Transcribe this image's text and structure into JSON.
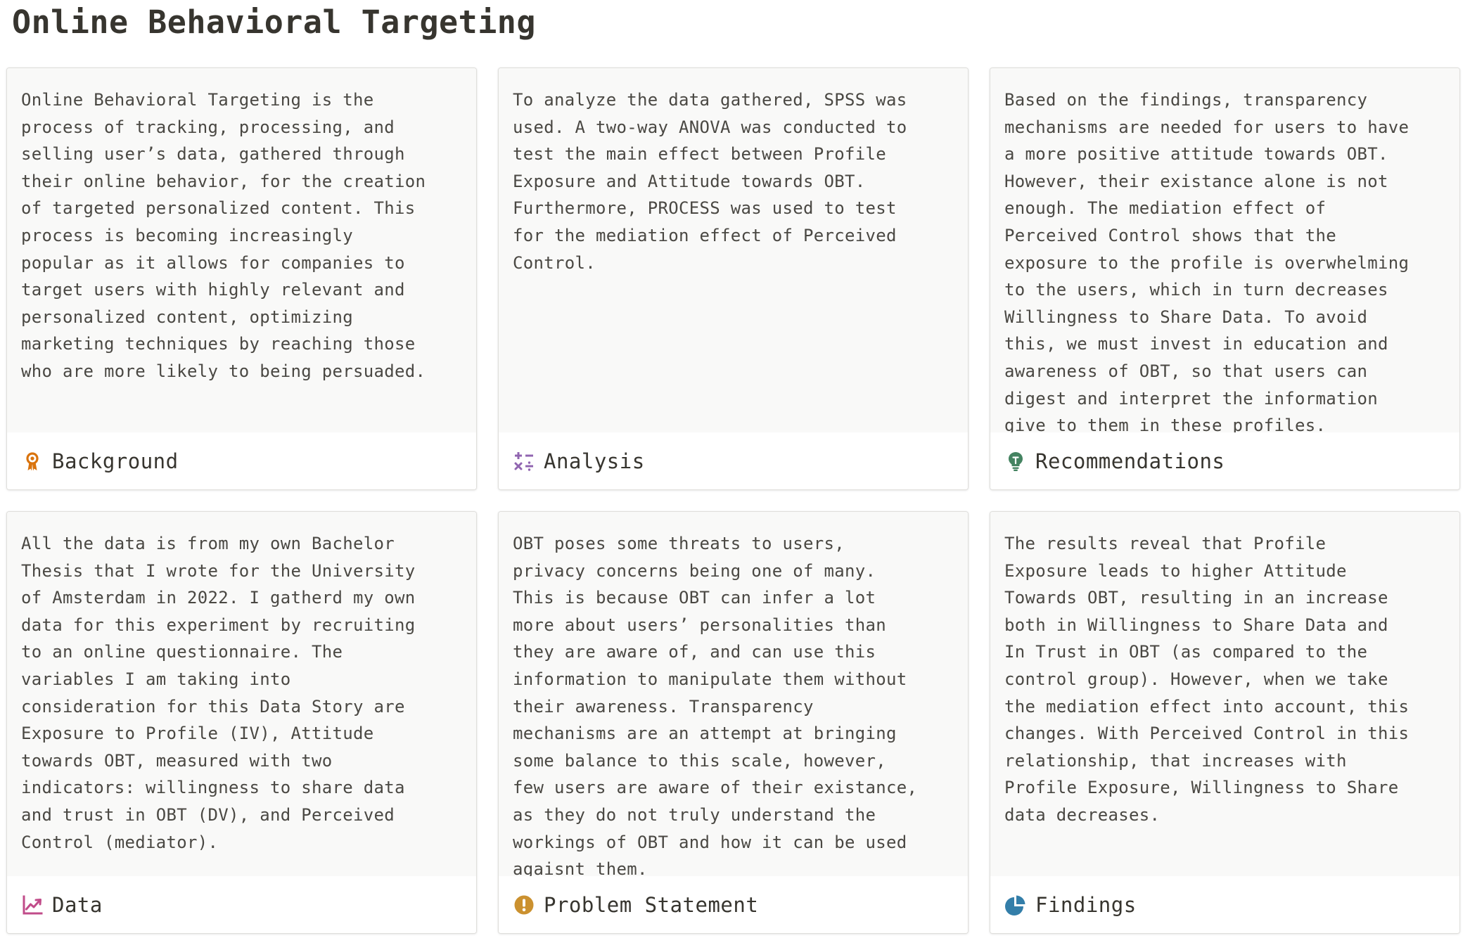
{
  "page": {
    "title": "Online Behavioral Targeting"
  },
  "colors": {
    "background_icon": "#d9730d",
    "analysis_icon": "#9065b0",
    "recommendations_icon": "#448361",
    "data_icon": "#c14c8a",
    "problem_icon": "#cb912f",
    "findings_icon": "#337ea9"
  },
  "cards": [
    {
      "title": "Background",
      "icon": "award-ribbon-icon",
      "text": "Online Behavioral Targeting is the\nprocess of tracking, processing, and\nselling user’s data, gathered through\ntheir online behavior, for the creation\nof targeted personalized content. This\nprocess is becoming increasingly\npopular as it allows for companies to\ntarget users with highly relevant and\npersonalized content, optimizing\nmarketing techniques by reaching those\nwho are more likely to being persuaded."
    },
    {
      "title": "Analysis",
      "icon": "calculator-operators-icon",
      "text": "To analyze the data gathered, SPSS was\nused. A two-way ANOVA was conducted to\ntest the main effect between Profile\nExposure and Attitude towards OBT.\nFurthermore, PROCESS was used to test\nfor the mediation effect of Perceived\nControl."
    },
    {
      "title": "Recommendations",
      "icon": "lightbulb-icon",
      "text": "Based on the findings, transparency\nmechanisms are needed for users to have\na more positive attitude towards OBT.\nHowever, their existance alone is not\nenough. The mediation effect of\nPerceived Control shows that the\nexposure to the profile is overwhelming\nto the users, which in turn decreases\nWillingness to Share Data. To avoid\nthis, we must invest in education and\nawareness of OBT, so that users can\ndigest and interpret the information\ngive to them in these profiles."
    },
    {
      "title": "Data",
      "icon": "trending-chart-icon",
      "text": "All the data is from my own Bachelor\nThesis that I wrote for the University\nof Amsterdam in 2022. I gatherd my own\ndata for this experiment by recruiting\nto an online questionnaire. The\nvariables I am taking into\nconsideration for this Data Story are\nExposure to Profile (IV), Attitude\ntowards OBT, measured with two\nindicators: willingness to share data\nand trust in OBT (DV), and Perceived\nControl (mediator)."
    },
    {
      "title": "Problem Statement",
      "icon": "exclamation-circle-icon",
      "text": "OBT poses some threats to users,\nprivacy concerns being one of many.\nThis is because OBT can infer a lot\nmore about users’ personalities than\nthey are aware of, and can use this\ninformation to manipulate them without\ntheir awareness. Transparency\nmechanisms are an attempt at bringing\nsome balance to this scale, however,\nfew users are aware of their existance,\nas they do not truly understand the\nworkings of OBT and how it can be used\nagaisnt them."
    },
    {
      "title": "Findings",
      "icon": "pie-chart-icon",
      "text": "The results reveal that Profile\nExposure leads to higher Attitude\nTowards OBT, resulting in an increase\nboth in Willingness to Share Data and\nIn Trust in OBT (as compared to the\ncontrol group). However, when we take\nthe mediation effect into account, this\nchanges. With Perceived Control in this\nrelationship, that increases with\nProfile Exposure, Willingness to Share\ndata decreases."
    }
  ]
}
